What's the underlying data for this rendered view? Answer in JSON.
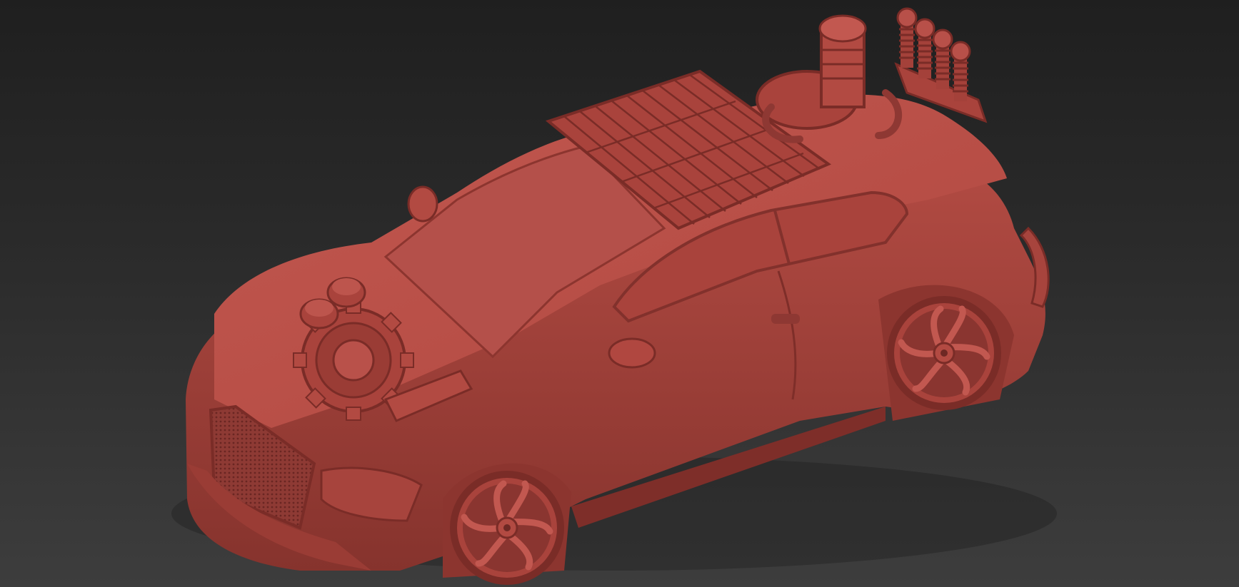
{
  "viewport": {
    "background_top": "#1f1f1f",
    "background_bottom": "#3d3d3d"
  },
  "model": {
    "subject": "car",
    "material_color": "#b8473f",
    "shade_dark": "#7e2e29",
    "shade_light": "#c85a51"
  }
}
